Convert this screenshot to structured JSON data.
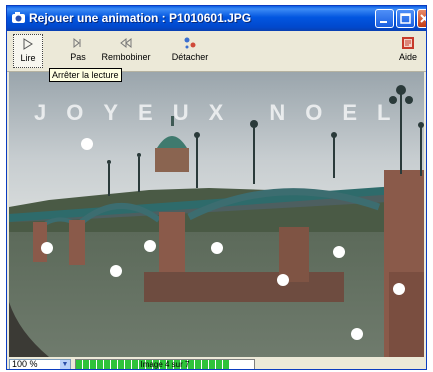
{
  "window": {
    "title": "Rejouer une animation :  P1010601.JPG"
  },
  "toolbar": {
    "lire": "Lire",
    "pas": "Pas",
    "rembobiner": "Rembobiner",
    "detacher": "Détacher",
    "aide": "Aide"
  },
  "tooltip": "Arrêter la lecture",
  "image": {
    "caption": "JOYEUX NOEL"
  },
  "status": {
    "zoom": "100 %",
    "progress_text": "Image 4 sur 7",
    "progress_fraction": 0.86
  },
  "colors": {
    "titlebar": "#0256e0",
    "progress": "#2fc33a"
  }
}
